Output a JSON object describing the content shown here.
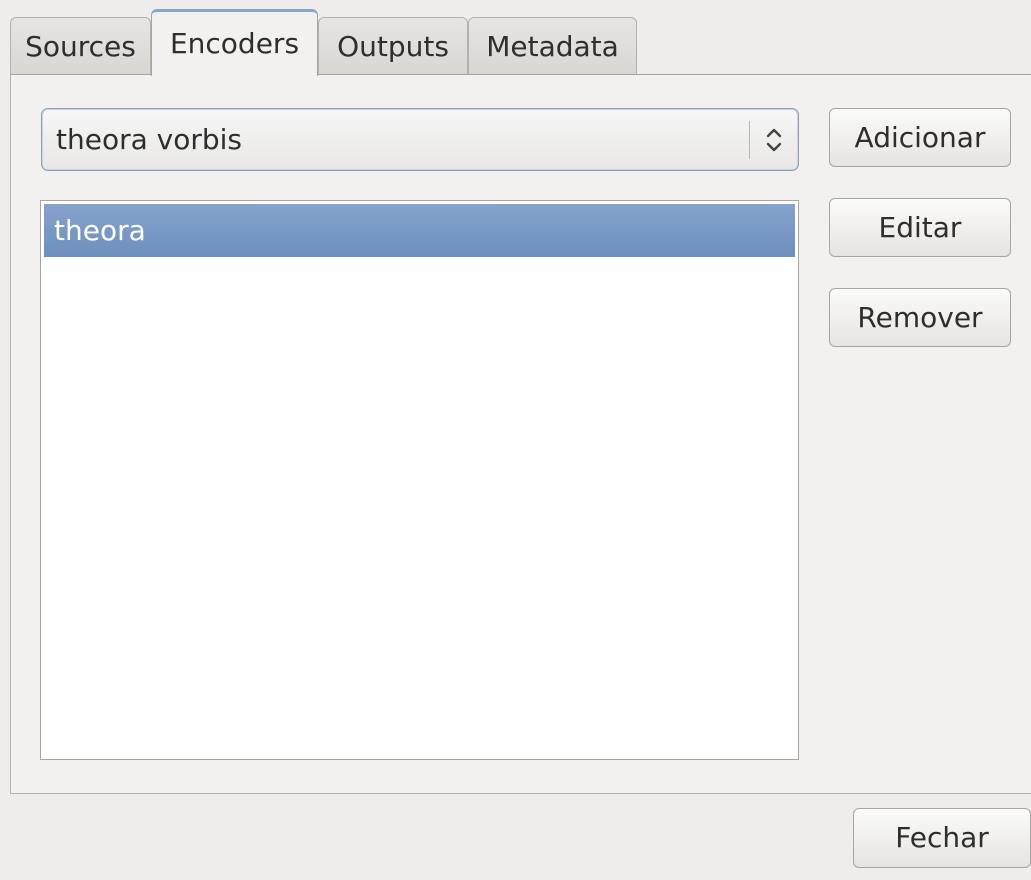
{
  "tabs": [
    {
      "label": "Sources",
      "active": false
    },
    {
      "label": "Encoders",
      "active": true
    },
    {
      "label": "Outputs",
      "active": false
    },
    {
      "label": "Metadata",
      "active": false
    }
  ],
  "encoders": {
    "combo_value": "theora vorbis",
    "list_items": [
      {
        "label": "theora",
        "selected": true
      }
    ],
    "buttons": {
      "add": "Adicionar",
      "edit": "Editar",
      "remove": "Remover"
    }
  },
  "footer": {
    "close": "Fechar"
  },
  "colors": {
    "selection": "#7797c4",
    "active_tab_accent": "#88a7c9",
    "window_bg": "#efedeb"
  },
  "icons": {
    "combo_arrow": "updown-chevron-icon"
  }
}
